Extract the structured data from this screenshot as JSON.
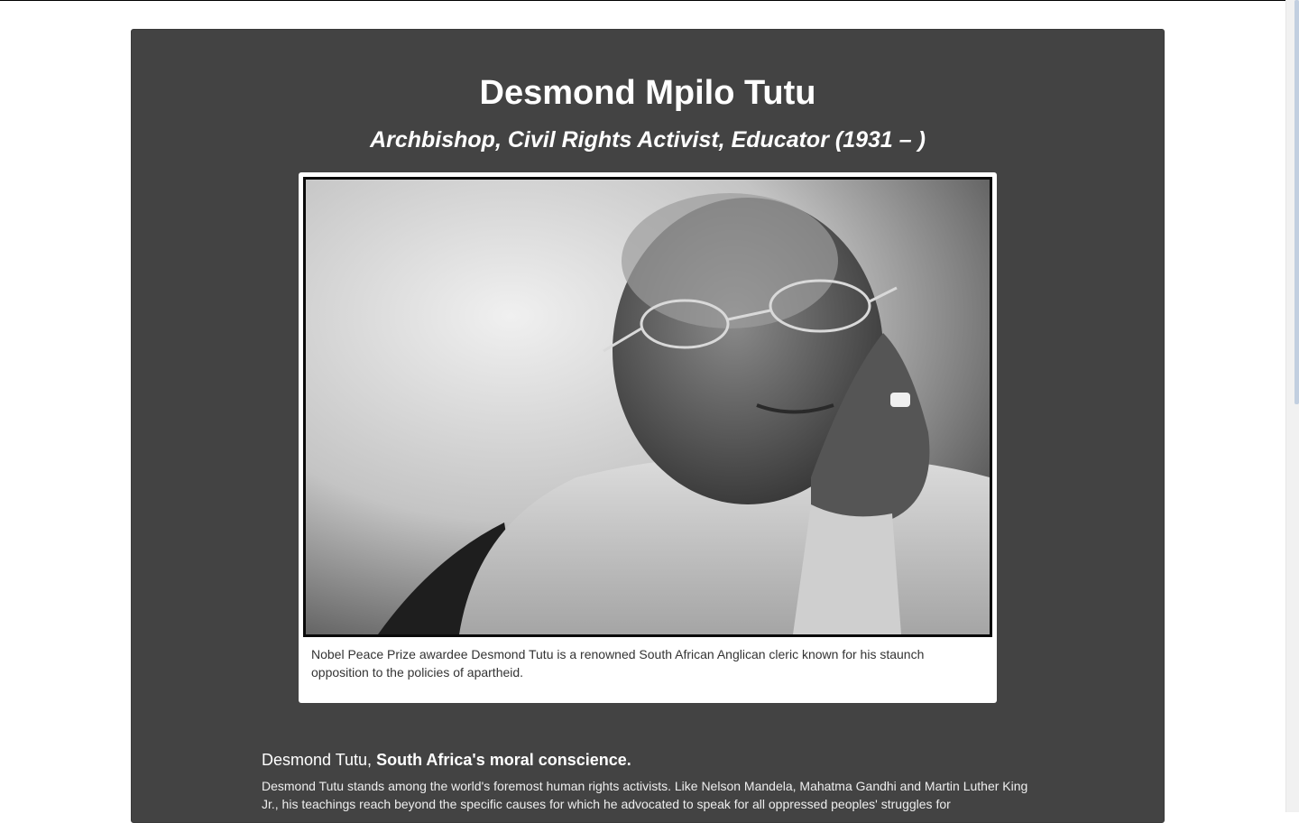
{
  "header": {
    "name": "Desmond Mpilo Tutu",
    "subtitle": "Archbishop, Civil Rights Activist, Educator (1931 – )"
  },
  "figure": {
    "caption": "Nobel Peace Prize awardee Desmond Tutu is a renowned South African Anglican cleric known for his staunch opposition to the policies of apartheid."
  },
  "article": {
    "lede_prefix": "Desmond Tutu, ",
    "lede_bold": "South Africa's moral conscience.",
    "paragraph": "Desmond Tutu stands among the world's foremost human rights activists. Like Nelson Mandela, Mahatma Gandhi and Martin Luther King Jr., his teachings reach beyond the specific causes for which he advocated to speak for all oppressed peoples' struggles for"
  },
  "colors": {
    "panel": "#434343",
    "page": "#ffffff"
  }
}
